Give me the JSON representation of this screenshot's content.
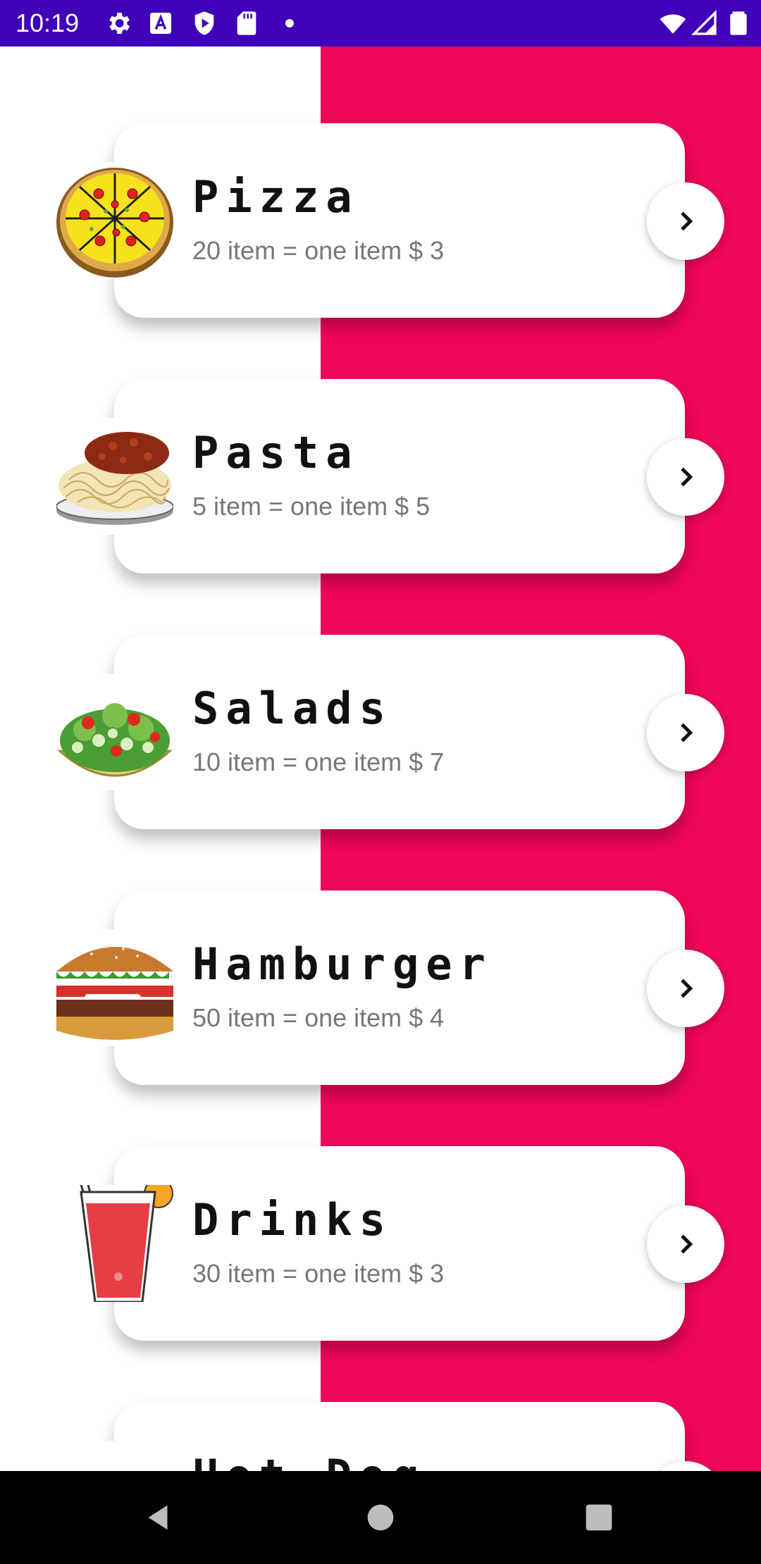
{
  "status_bar": {
    "time": "10:19",
    "left_icons": [
      "gear-icon",
      "a-app-icon",
      "shield-play-icon",
      "sd-card-icon",
      "dot-icon"
    ],
    "right_icons": [
      "wifi-icon",
      "signal-icon",
      "battery-icon"
    ],
    "background": "#3F02B8"
  },
  "theme": {
    "accent": "#F0065A",
    "card_background": "#FFFFFF",
    "subtitle_color": "#777777"
  },
  "menu": {
    "items": [
      {
        "name": "Pizza",
        "detail": "20 item = one item $ 3",
        "icon": "pizza-image"
      },
      {
        "name": "Pasta",
        "detail": "5 item = one item $ 5",
        "icon": "pasta-image"
      },
      {
        "name": "Salads",
        "detail": "10 item = one item $ 7",
        "icon": "salad-image"
      },
      {
        "name": "Hamburger",
        "detail": "50 item = one item $ 4",
        "icon": "hamburger-image"
      },
      {
        "name": "Drinks",
        "detail": "30 item = one item $ 3",
        "icon": "drink-image"
      },
      {
        "name": "Hot Dog",
        "detail": "",
        "icon": "hotdog-image"
      }
    ]
  },
  "nav_bar": {
    "buttons": [
      "back-icon",
      "home-icon",
      "recents-icon"
    ]
  }
}
